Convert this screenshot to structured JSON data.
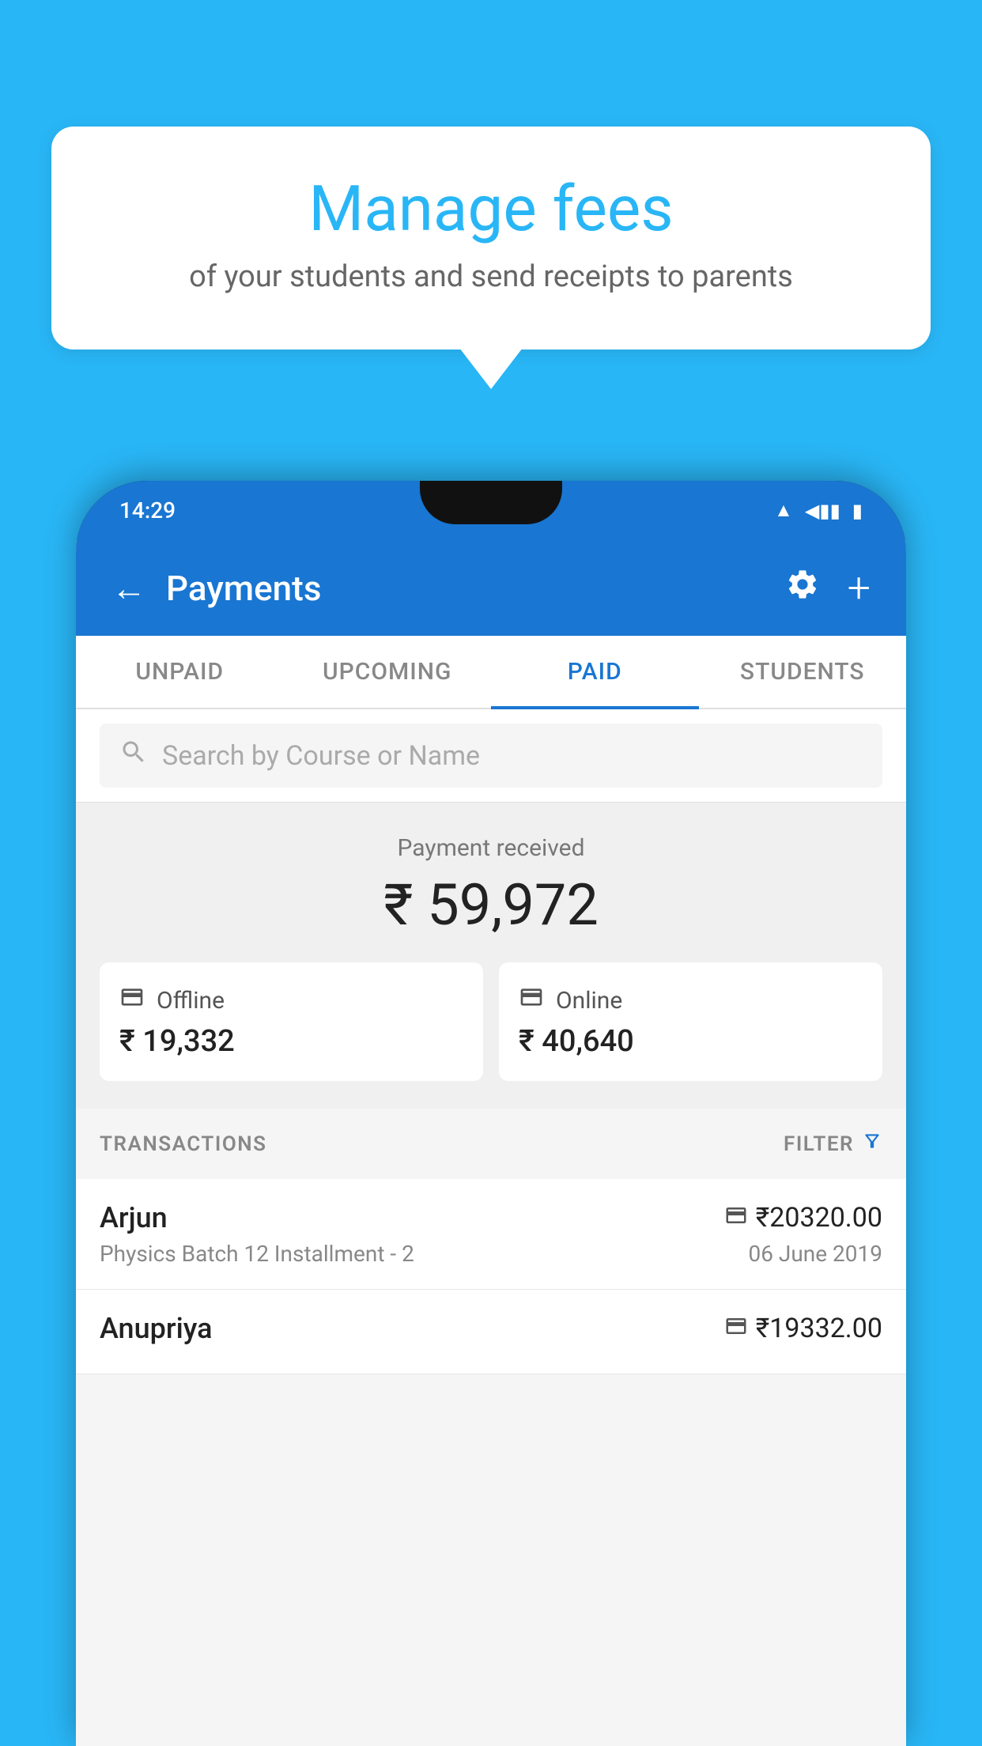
{
  "page": {
    "background_color": "#29b6f6"
  },
  "tooltip": {
    "title": "Manage fees",
    "subtitle": "of your students and send receipts to parents"
  },
  "status_bar": {
    "time": "14:29",
    "wifi_icon": "wifi",
    "signal_icon": "signal",
    "battery_icon": "battery"
  },
  "header": {
    "back_label": "←",
    "title": "Payments",
    "settings_icon": "gear",
    "add_icon": "+"
  },
  "tabs": [
    {
      "label": "UNPAID",
      "active": false
    },
    {
      "label": "UPCOMING",
      "active": false
    },
    {
      "label": "PAID",
      "active": true
    },
    {
      "label": "STUDENTS",
      "active": false
    }
  ],
  "search": {
    "placeholder": "Search by Course or Name"
  },
  "payment_summary": {
    "label": "Payment received",
    "total_amount": "₹ 59,972",
    "offline": {
      "icon": "offline-payment",
      "label": "Offline",
      "amount": "₹ 19,332"
    },
    "online": {
      "icon": "online-payment",
      "label": "Online",
      "amount": "₹ 40,640"
    }
  },
  "transactions": {
    "header_label": "TRANSACTIONS",
    "filter_label": "FILTER",
    "items": [
      {
        "name": "Arjun",
        "course": "Physics Batch 12 Installment - 2",
        "amount": "₹20320.00",
        "date": "06 June 2019",
        "payment_type": "online"
      },
      {
        "name": "Anupriya",
        "course": "",
        "amount": "₹19332.00",
        "date": "",
        "payment_type": "offline"
      }
    ]
  }
}
